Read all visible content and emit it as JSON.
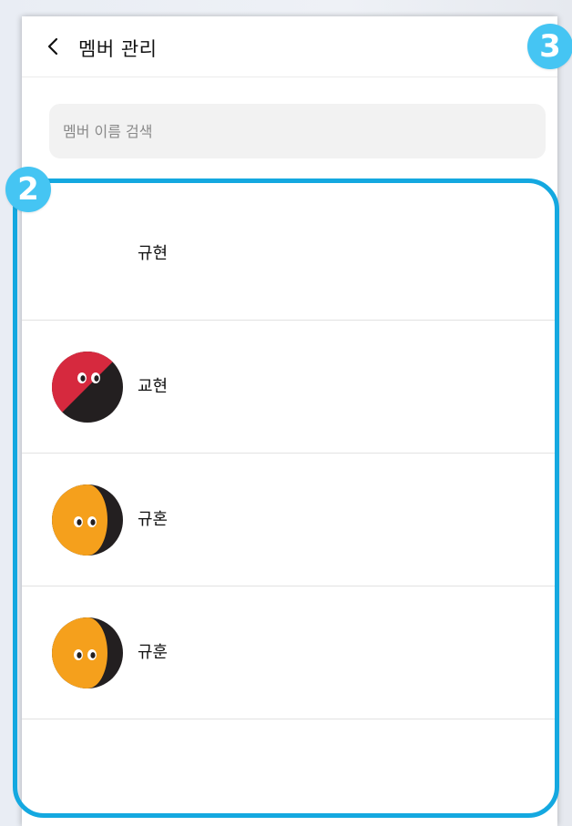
{
  "header": {
    "title": "멤버 관리",
    "back_icon": "chevron-left-icon"
  },
  "search": {
    "placeholder": "멤버 이름 검색",
    "value": ""
  },
  "members": [
    {
      "name": "규현",
      "avatar": "none"
    },
    {
      "name": "교현",
      "avatar": "red-black-character"
    },
    {
      "name": "규혼",
      "avatar": "orange-black-character"
    },
    {
      "name": "규훈",
      "avatar": "orange-black-character"
    }
  ],
  "annotations": {
    "badge_2": "2",
    "badge_3": "3"
  },
  "colors": {
    "highlight": "#14a8e0",
    "badge": "#45c5f3",
    "red_avatar": "#d6293e",
    "orange_avatar": "#f5a01c",
    "avatar_dark": "#231f20"
  }
}
